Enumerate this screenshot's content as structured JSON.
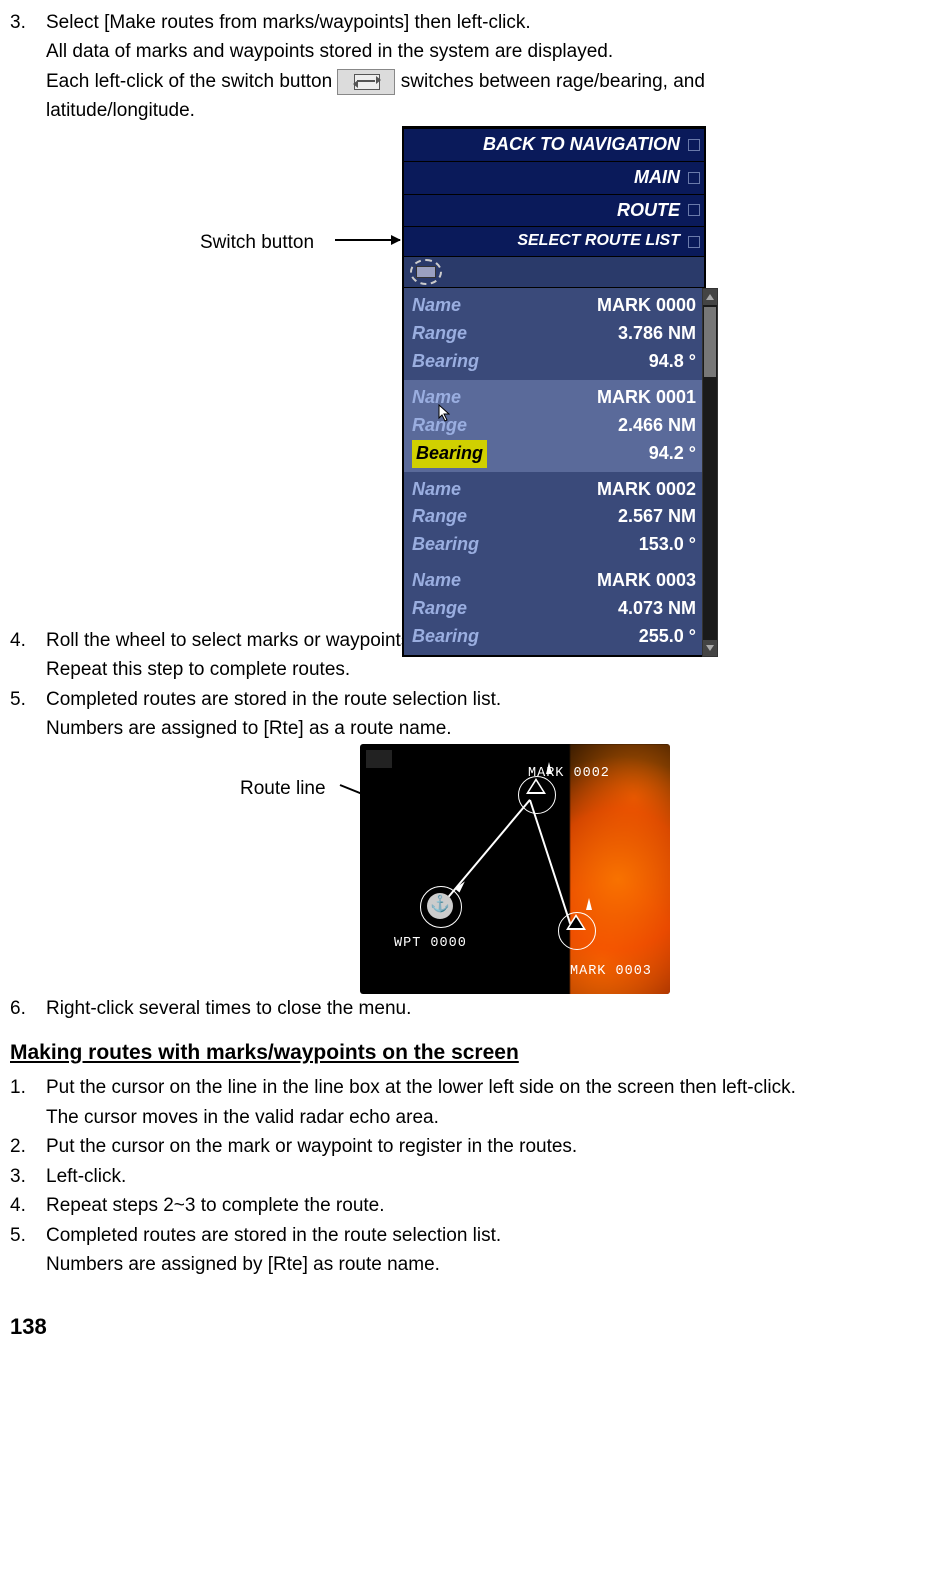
{
  "step3": {
    "num": "3.",
    "line1": "Select [Make routes from marks/waypoints] then left-click.",
    "line2": "All data of marks and waypoints stored in the system are displayed.",
    "line3a": "Each left-click of the switch button",
    "line3b": "switches between rage/bearing, and",
    "line4": "latitude/longitude."
  },
  "fig1": {
    "switch_label": "Switch button",
    "nav": {
      "back": "BACK TO NAVIGATION",
      "main": "MAIN",
      "route": "ROUTE",
      "select": "SELECT ROUTE LIST"
    },
    "labels": {
      "name": "Name",
      "range": "Range",
      "bearing": "Bearing"
    },
    "marks": [
      {
        "name": "MARK 0000",
        "range": "3.786 NM",
        "bearing": "94.8 °"
      },
      {
        "name": "MARK 0001",
        "range": "2.466 NM",
        "bearing": "94.2 °"
      },
      {
        "name": "MARK 0002",
        "range": "2.567 NM",
        "bearing": "153.0 °"
      },
      {
        "name": "MARK 0003",
        "range": "4.073 NM",
        "bearing": "255.0 °"
      }
    ]
  },
  "step4": {
    "num": "4.",
    "line1": "Roll the wheel to select marks or waypoints to register for routes then left-click.",
    "line2": "Repeat this step to complete routes."
  },
  "step5": {
    "num": "5.",
    "line1": "Completed routes are stored in the route selection list.",
    "line2": "Numbers are assigned to [Rte] as a route name."
  },
  "fig2": {
    "route_label": "Route line",
    "wpt": "WPT 0000",
    "mark2": "MARK 0002",
    "mark3": "MARK 0003"
  },
  "step6": {
    "num": "6.",
    "line1": "Right-click several times to close the menu."
  },
  "section_heading": "Making routes with marks/waypoints on the screen",
  "b1": {
    "num": "1.",
    "line1": "Put the cursor on the line in the line box at the lower left side on the screen then left-click.",
    "line2": "The cursor moves in the valid radar echo area."
  },
  "b2": {
    "num": "2.",
    "line1": "Put the cursor on the mark or waypoint to register in the routes."
  },
  "b3": {
    "num": "3.",
    "line1": "Left-click."
  },
  "b4": {
    "num": "4.",
    "line1": "Repeat steps 2~3 to complete the route."
  },
  "b5": {
    "num": "5.",
    "line1": "Completed routes are stored in the route selection list.",
    "line2": "Numbers are assigned by [Rte] as route name."
  },
  "page_number": "138"
}
